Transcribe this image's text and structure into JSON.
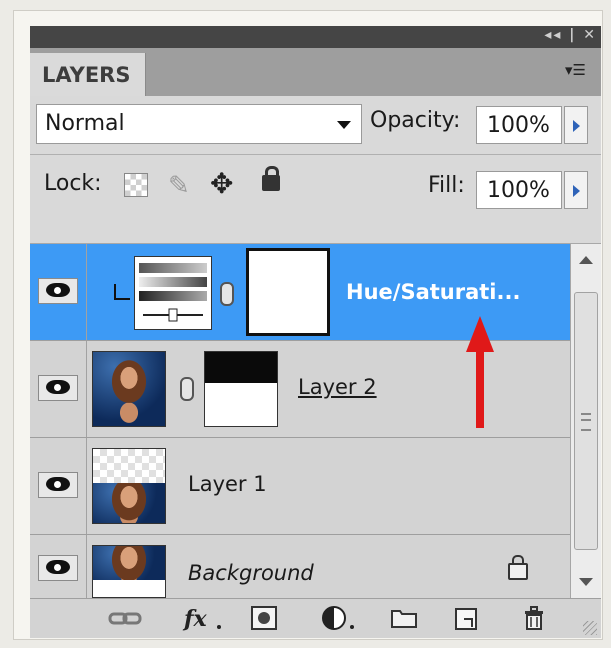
{
  "panel": {
    "tab_label": "LAYERS",
    "menu_icon": "panel-menu-icon"
  },
  "controls": {
    "blend_mode": "Normal",
    "opacity_label": "Opacity:",
    "opacity_value": "100%",
    "lock_label": "Lock:",
    "fill_label": "Fill:",
    "fill_value": "100%"
  },
  "layers": [
    {
      "name": "Hue/Saturati...",
      "selected": true,
      "type": "adjustment"
    },
    {
      "name": "Layer 2",
      "selected": false,
      "type": "image-with-mask"
    },
    {
      "name": "Layer 1",
      "selected": false,
      "type": "image"
    },
    {
      "name": "Background",
      "selected": false,
      "type": "background",
      "locked": true
    }
  ],
  "footer_icons": [
    "link-layers-icon",
    "fx-icon",
    "add-mask-icon",
    "adjustment-layer-icon",
    "new-group-icon",
    "new-layer-icon",
    "delete-layer-icon"
  ],
  "colors": {
    "selection": "#3d9af5",
    "annotation_arrow": "#e01919"
  }
}
